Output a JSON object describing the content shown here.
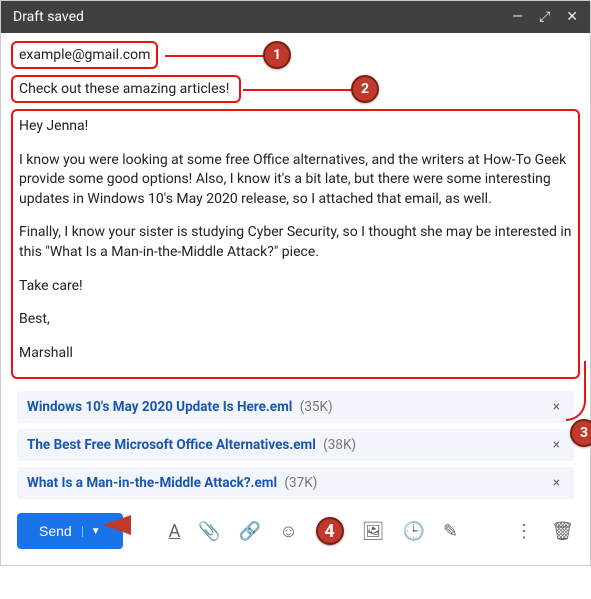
{
  "titlebar": {
    "title": "Draft saved"
  },
  "to": {
    "value": "example@gmail.com"
  },
  "subject": {
    "value": "Check out these amazing articles!"
  },
  "body": {
    "p1": "Hey Jenna!",
    "p2": "I know you were looking at some free Office alternatives, and the writers at How-To Geek provide some good options! Also, I know it's a bit late, but there were some interesting updates in Windows 10's May 2020 release, so I attached that email, as well.",
    "p3": "Finally, I know your sister is studying Cyber Security, so I thought she may be interested in this \"What Is a Man-in-the-Middle Attack?\" piece.",
    "p4": "Take care!",
    "p5": "Best,",
    "p6": "Marshall"
  },
  "attachments": [
    {
      "name": "Windows 10's May 2020 Update Is Here.eml",
      "size": "(35K)"
    },
    {
      "name": "The Best Free Microsoft Office Alternatives.eml",
      "size": "(38K)"
    },
    {
      "name": "What Is a Man-in-the-Middle Attack?.eml",
      "size": "(37K)"
    }
  ],
  "footer": {
    "send": "Send"
  },
  "callouts": {
    "c1": "1",
    "c2": "2",
    "c3": "3",
    "c4": "4"
  }
}
